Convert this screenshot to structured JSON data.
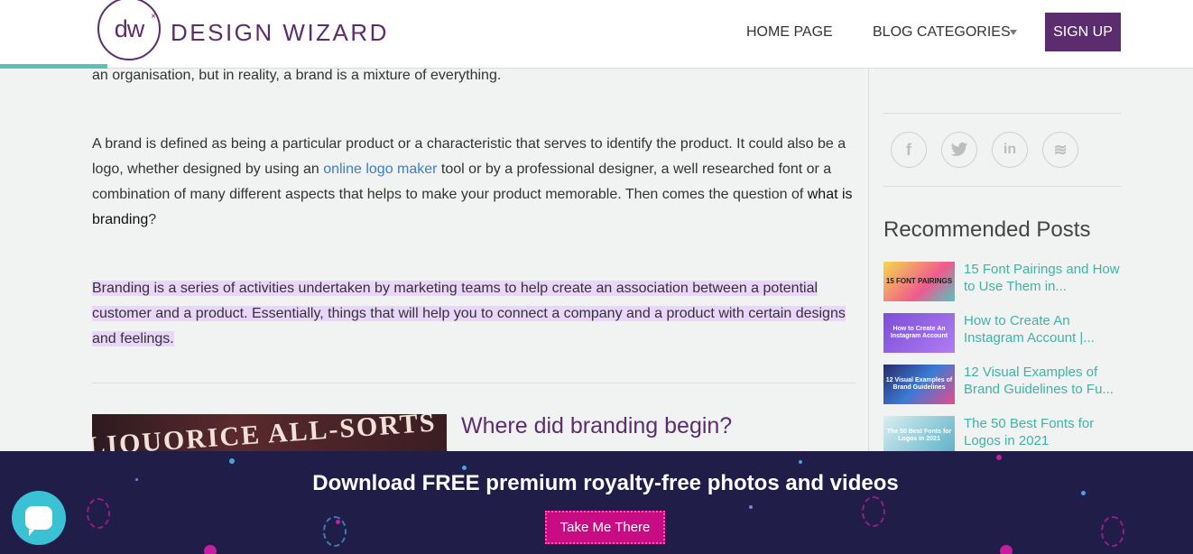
{
  "header": {
    "logo_mark": "dw",
    "logo_text": "DESIGN WIZARD",
    "nav": {
      "home": "HOME PAGE",
      "blog_categories": "BLOG CATEGORIES",
      "signup": "SIGN UP"
    },
    "reading_progress_percent": 9
  },
  "article": {
    "p0": "an organisation, but in reality, a brand is a mixture of everything.",
    "p1_a": "A brand is defined as being a particular product or a characteristic that serves to identify the product. It could also be a logo, whether designed by using an ",
    "p1_link": "online logo maker",
    "p1_b": " tool or by a professional designer, a well researched font or a combination of many different aspects that helps to make your product memorable. Then comes the question of ",
    "p1_bold": "what is branding",
    "p1_c": "?",
    "p2": "Branding is a series of activities undertaken by marketing teams to help create an association between a potential customer and a product. Essentially, things that will help you to connect a company and a product with certain designs and feelings.",
    "image_text": "LIQUORICE ALL-SORTS",
    "section_heading": "Where did branding begin?"
  },
  "sidebar": {
    "social": [
      {
        "label": "f",
        "icon": "facebook-icon"
      },
      {
        "label": "t",
        "icon": "twitter-icon"
      },
      {
        "label": "in",
        "icon": "linkedin-icon"
      },
      {
        "label": "≋",
        "icon": "buffer-icon"
      }
    ],
    "recommended_title": "Recommended Posts",
    "posts": [
      {
        "title": "15 Font Pairings and How to Use Them in...",
        "thumb_text": "15 FONT PAIRINGS"
      },
      {
        "title": "How to Create An Instagram Account |...",
        "thumb_text": "How to Create An Instagram Account"
      },
      {
        "title": "12 Visual Examples of Brand Guidelines to Fu...",
        "thumb_text": "12 Visual Examples of Brand Guidelines"
      },
      {
        "title": "The 50 Best Fonts for Logos in 2021",
        "thumb_text": "The 50 Best Fonts for Logos in 2021"
      }
    ]
  },
  "banner": {
    "title": "Download FREE premium royalty-free photos and videos",
    "cta": "Take Me There"
  },
  "colors": {
    "brand_purple": "#5b2d6e",
    "teal": "#3fb3a4",
    "highlight": "#ead5fb",
    "banner_bg": "#201d49",
    "cta_pink": "#c80d84"
  }
}
